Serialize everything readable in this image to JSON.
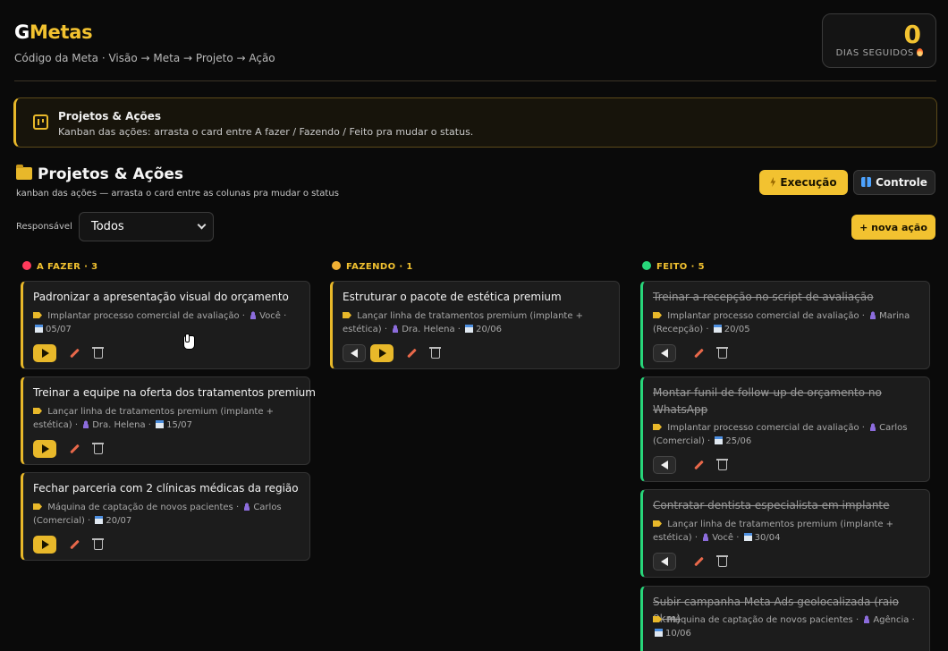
{
  "app": {
    "logo_g": "G",
    "logo_metas": "Metas",
    "subtitle": "Código da Meta · Visão → Meta → Projeto → Ação"
  },
  "streak": {
    "value": "0",
    "label": "DIAS SEGUIDOS"
  },
  "banner": {
    "title": "Projetos & Ações",
    "description": "Kanban das ações: arrasta o card entre A fazer / Fazendo / Feito pra mudar o status."
  },
  "section": {
    "title": "Projetos & Ações",
    "subtitle": "kanban das ações — arrasta o card entre as colunas pra mudar o status"
  },
  "toolbar": {
    "execucao_label": "Execução",
    "controle_label": "Controle",
    "responsavel_label": "Responsável",
    "responsavel_value": "Todos",
    "nova_acao_label": "+ nova ação"
  },
  "colors": {
    "accent": "#f2c230",
    "todo": "#ff3b5c",
    "doing": "#f2b134",
    "done": "#28d67a"
  },
  "columns": [
    {
      "title": "A FAZER · 3",
      "cards": [
        {
          "title": "Padronizar a apresentação visual do orçamento",
          "project": "Implantar processo comercial de avaliação",
          "owner": "Você",
          "date": "05/07"
        },
        {
          "title": "Treinar a equipe na oferta dos tratamentos premium",
          "project": "Lançar linha de tratamentos premium (implante + estética)",
          "owner": "Dra. Helena",
          "date": "15/07"
        },
        {
          "title": "Fechar parceria com 2 clínicas médicas da região",
          "project": "Máquina de captação de novos pacientes",
          "owner": "Carlos (Comercial)",
          "date": "20/07"
        }
      ]
    },
    {
      "title": "FAZENDO · 1",
      "cards": [
        {
          "title": "Estruturar o pacote de estética premium",
          "project": "Lançar linha de tratamentos premium (implante + estética)",
          "owner": "Dra. Helena",
          "date": "20/06"
        }
      ]
    },
    {
      "title": "FEITO · 5",
      "cards": [
        {
          "title": "Treinar a recepção no script de avaliação",
          "project": "Implantar processo comercial de avaliação",
          "owner": "Marina (Recepção)",
          "date": "20/05"
        },
        {
          "title": "Montar funil de follow-up de orçamento no WhatsApp",
          "project": "Implantar processo comercial de avaliação",
          "owner": "Carlos (Comercial)",
          "date": "25/06"
        },
        {
          "title": "Contratar dentista especialista em implante",
          "project": "Lançar linha de tratamentos premium (implante + estética)",
          "owner": "Você",
          "date": "30/04"
        },
        {
          "title": "Subir campanha Meta Ads geolocalizada (raio 8km)",
          "project": "Máquina de captação de novos pacientes",
          "owner": "Agência",
          "date": "10/06"
        }
      ]
    }
  ]
}
